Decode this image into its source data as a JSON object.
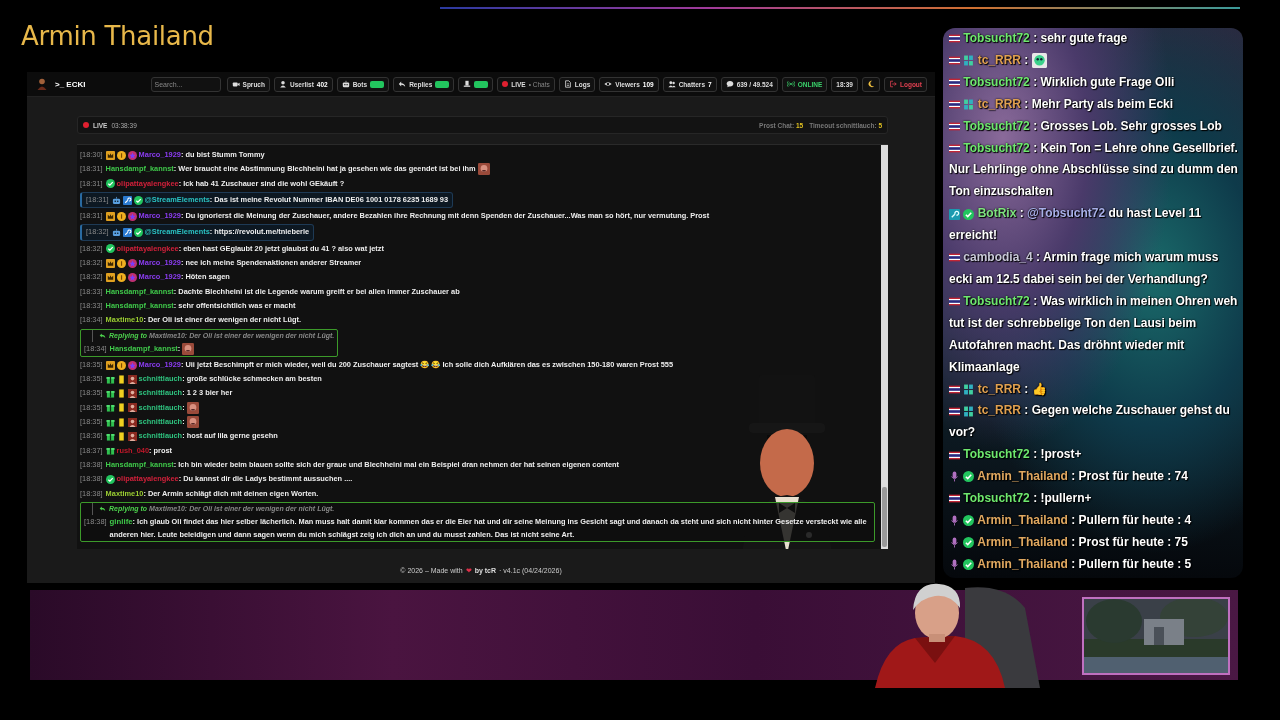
{
  "stream_title": "Armin Thailand",
  "nav": {
    "avatar": true,
    "logo": ">_ ECKI",
    "items": [
      {
        "kind": "search",
        "placeholder": "Search..."
      },
      {
        "kind": "button",
        "label": "Spruch"
      },
      {
        "kind": "button",
        "label": "Userlist",
        "count": "402"
      },
      {
        "kind": "toggle",
        "label": "Bots",
        "on": true
      },
      {
        "kind": "toggle",
        "label": "Replies",
        "on": true
      },
      {
        "kind": "toggle",
        "on": true
      },
      {
        "kind": "live",
        "label": "LIVE",
        "sub": "• Chats"
      },
      {
        "kind": "button",
        "label": "Logs"
      },
      {
        "kind": "button",
        "label": "Viewers",
        "count": "109"
      },
      {
        "kind": "button",
        "label": "Chatters",
        "count": "7"
      },
      {
        "kind": "button",
        "label": "639 / 49.524"
      },
      {
        "kind": "status",
        "label": "ONLINE"
      },
      {
        "kind": "plain",
        "label": "18:39"
      },
      {
        "kind": "button"
      },
      {
        "kind": "logout",
        "label": "Logout"
      }
    ]
  },
  "chat": {
    "live_label": "LIVE",
    "uptime": "03:38:39",
    "stats": [
      {
        "label": "Prost Chat:",
        "value": "15"
      },
      {
        "label": "Timeout schnittlauch:",
        "value": "5"
      }
    ],
    "separator": ":",
    "messages": [
      {
        "kind": "plain",
        "time": "[18:30]",
        "badges": [
          {
            "kind": "crown"
          },
          {
            "kind": "coin"
          },
          {
            "kind": "star"
          }
        ],
        "user": "Marco_1929",
        "color": "#8a3cf0",
        "text": "du bist Stumm Tommy"
      },
      {
        "kind": "plain",
        "time": "[18:31]",
        "user": "Hansdampf_kannst",
        "color": "#3fc94a",
        "text": "Wer braucht eine Abstimmung Blechheini hat ja gesehen wie das geendet ist bei ihm",
        "emote": true
      },
      {
        "kind": "plain",
        "time": "[18:31]",
        "badges": [
          {
            "kind": "check"
          }
        ],
        "user": "olipattayalengkee",
        "color": "#d0203a",
        "text": "Ick hab 41 Zuschauer sind die wohl GEkäuft ?"
      },
      {
        "kind": "highlight",
        "time": "[18:31]",
        "badges": [
          {
            "kind": "bot"
          },
          {
            "kind": "wrench"
          },
          {
            "kind": "check"
          }
        ],
        "user": "@StreamElements",
        "color": "#2ac1c1",
        "text": "Das ist meine Revolut Nummer IBAN DE06 1001 0178 6235 1689 93"
      },
      {
        "kind": "plain",
        "time": "[18:31]",
        "badges": [
          {
            "kind": "crown"
          },
          {
            "kind": "coin"
          },
          {
            "kind": "star"
          }
        ],
        "user": "Marco_1929",
        "color": "#8a3cf0",
        "text": "Du ignorierst die Meinung der Zuschauer, andere Bezahlen ihre Rechnung mit denn Spenden der Zuschauer...Was man so hört, nur vermutung. Prost"
      },
      {
        "kind": "highlight",
        "time": "[18:32]",
        "badges": [
          {
            "kind": "bot"
          },
          {
            "kind": "wrench"
          },
          {
            "kind": "check"
          }
        ],
        "user": "@StreamElements",
        "color": "#2ac1c1",
        "text": "https://revolut.me/tnieberle"
      },
      {
        "kind": "plain",
        "time": "[18:32]",
        "badges": [
          {
            "kind": "check"
          }
        ],
        "user": "olipattayalengkee",
        "color": "#d0203a",
        "text": "eben hast GEglaubt 20 jetzt glaubst du 41 ? also wat jetzt"
      },
      {
        "kind": "plain",
        "time": "[18:32]",
        "badges": [
          {
            "kind": "crown"
          },
          {
            "kind": "coin"
          },
          {
            "kind": "star"
          }
        ],
        "user": "Marco_1929",
        "color": "#8a3cf0",
        "text": "nee ich meine Spendenaktionen anderer Streamer"
      },
      {
        "kind": "plain",
        "time": "[18:32]",
        "badges": [
          {
            "kind": "crown"
          },
          {
            "kind": "coin"
          },
          {
            "kind": "star"
          }
        ],
        "user": "Marco_1929",
        "color": "#8a3cf0",
        "text": "Höten sagen"
      },
      {
        "kind": "plain",
        "time": "[18:33]",
        "user": "Hansdampf_kannst",
        "color": "#3fc94a",
        "text": "Dachte Blechheini ist die Legende warum greift er bei allen immer Zuschauer ab"
      },
      {
        "kind": "plain",
        "time": "[18:33]",
        "user": "Hansdampf_kannst",
        "color": "#3fc94a",
        "text": "sehr offentsichtlich was er macht"
      },
      {
        "kind": "plain",
        "time": "[18:34]",
        "user": "Maxtime10",
        "color": "#9acd32",
        "text": "Der Oli ist einer der wenigen der nicht Lügt."
      },
      {
        "kind": "reply",
        "reply_label": "Replying to",
        "reply_quote": "Maxtime10: Der Oli ist einer der wenigen der nicht Lügt.",
        "time": "[18:34]",
        "user": "Hansdampf_kannst",
        "color": "#3fc94a",
        "emote": true
      },
      {
        "kind": "plain",
        "time": "[18:35]",
        "badges": [
          {
            "kind": "crown"
          },
          {
            "kind": "coin"
          },
          {
            "kind": "star"
          }
        ],
        "user": "Marco_1929",
        "color": "#8a3cf0",
        "text": "Uii jetzt Beschimpft er mich wieder, weil du 200 Zuschauer sagtest 😂 😂 Ich solle dich Aufklären das es zwischen 150-180 waren Prost 555"
      },
      {
        "kind": "plain",
        "time": "[18:35]",
        "badges": [
          {
            "kind": "gift"
          },
          {
            "kind": "note"
          },
          {
            "kind": "avatar"
          }
        ],
        "user": "schnittlauch",
        "color": "#2ec27e",
        "text": "große schlücke schmecken am besten"
      },
      {
        "kind": "plain",
        "time": "[18:35]",
        "badges": [
          {
            "kind": "gift"
          },
          {
            "kind": "note"
          },
          {
            "kind": "avatar"
          }
        ],
        "user": "schnittlauch",
        "color": "#2ec27e",
        "text": "1 2 3 bier her"
      },
      {
        "kind": "plain",
        "time": "[18:35]",
        "badges": [
          {
            "kind": "gift"
          },
          {
            "kind": "note"
          },
          {
            "kind": "avatar"
          }
        ],
        "user": "schnittlauch",
        "color": "#2ec27e",
        "emote": true
      },
      {
        "kind": "plain",
        "time": "[18:35]",
        "badges": [
          {
            "kind": "gift"
          },
          {
            "kind": "note"
          },
          {
            "kind": "avatar"
          }
        ],
        "user": "schnittlauch",
        "color": "#2ec27e",
        "emote": true
      },
      {
        "kind": "plain",
        "time": "[18:36]",
        "badges": [
          {
            "kind": "gift"
          },
          {
            "kind": "note"
          },
          {
            "kind": "avatar"
          }
        ],
        "user": "schnittlauch",
        "color": "#2ec27e",
        "text": "host auf lila gerne gesehn"
      },
      {
        "kind": "plain",
        "time": "[18:37]",
        "badges": [
          {
            "kind": "gift"
          }
        ],
        "user": "rush_040",
        "color": "#c0182a",
        "text": "prost"
      },
      {
        "kind": "plain",
        "time": "[18:38]",
        "user": "Hansdampf_kannst",
        "color": "#3fc94a",
        "text": "Ich bin wieder beim blauen sollte sich der graue und Blechheini mal ein Beispiel dran nehmen der hat seinen eigenen content"
      },
      {
        "kind": "plain",
        "time": "[18:38]",
        "badges": [
          {
            "kind": "check"
          }
        ],
        "user": "olipattayalengkee",
        "color": "#d0203a",
        "text": "Du kannst dir die Ladys bestimmt aussuchen ...."
      },
      {
        "kind": "plain",
        "time": "[18:38]",
        "user": "Maxtime10",
        "color": "#9acd32",
        "text": "Der Armin schlägt dich mit deinen eigen Worten."
      },
      {
        "kind": "reply",
        "reply_label": "Replying to",
        "reply_quote": "Maxtime10: Der Oli ist einer der wenigen der nicht Lügt.",
        "time": "[18:38]",
        "user": "ginlife",
        "color": "#3fc94a",
        "text": "Ich glaub Oli findet das hier selber lächerlich. Man muss halt damit klar kommen das er die Eier hat und dir seine Meinung ins Gesicht sagt und danach da steht und sich nicht hinter Gesetze versteckt wie alle anderen hier. Leute beleidigen und dann sagen wenn du mich schlägst zeig ich dich an und du musst zahlen. Das ist nicht seine Art."
      }
    ]
  },
  "footer": {
    "text": "© 2026 – Made with",
    "heart": "❤",
    "author": "by tcR",
    "version": "· v4.1c (04/24/2026)"
  },
  "overlay_chat": {
    "separator": " : ",
    "messages": [
      {
        "badges": [
          {
            "kind": "flag"
          }
        ],
        "user": "Tobsucht72",
        "color": "#6ee86e",
        "text": "sehr gute frage"
      },
      {
        "badges": [
          {
            "kind": "flag"
          },
          {
            "kind": "sub"
          }
        ],
        "user": "tc_RRR",
        "color": "#e0a050",
        "emote": true
      },
      {
        "badges": [
          {
            "kind": "flag"
          }
        ],
        "user": "Tobsucht72",
        "color": "#6ee86e",
        "text": "Wirklich gute Frage Olli"
      },
      {
        "badges": [
          {
            "kind": "flag"
          },
          {
            "kind": "sub"
          }
        ],
        "user": "tc_RRR",
        "color": "#e0a050",
        "text": "Mehr Party als beim Ecki"
      },
      {
        "badges": [
          {
            "kind": "flag"
          }
        ],
        "user": "Tobsucht72",
        "color": "#6ee86e",
        "text": "Grosses Lob. Sehr grosses Lob"
      },
      {
        "badges": [
          {
            "kind": "flag"
          }
        ],
        "user": "Tobsucht72",
        "color": "#6ee86e",
        "text": "Kein Ton = Lehre ohne Gesellbrief. Nur Lehrlinge ohne Abschlüsse sind zu dumm den Ton einzuschalten"
      },
      {
        "badges": [
          {
            "kind": "kick"
          },
          {
            "kind": "check"
          }
        ],
        "user": "BotRix",
        "color": "#7ee37e",
        "mention": "@Tobsucht72",
        "text": "du hast Level 11 erreicht!"
      },
      {
        "badges": [
          {
            "kind": "flag"
          }
        ],
        "user": "cambodia_4",
        "color": "#c8c8d8",
        "text": "Armin frage mich warum muss ecki am 12.5 dabei sein bei der Verhandlung?"
      },
      {
        "badges": [
          {
            "kind": "flag"
          }
        ],
        "user": "Tobsucht72",
        "color": "#6ee86e",
        "text": "Was wirklich in meinen Ohren weh tut ist der schrebbelige Ton den Lausi beim Autofahren macht. Das dröhnt wieder mit Klimaanlage"
      },
      {
        "badges": [
          {
            "kind": "flag"
          },
          {
            "kind": "sub"
          }
        ],
        "user": "tc_RRR",
        "color": "#e0a050",
        "text": "👍"
      },
      {
        "badges": [
          {
            "kind": "flag"
          },
          {
            "kind": "sub"
          }
        ],
        "user": "tc_RRR",
        "color": "#e0a050",
        "text": "Gegen welche Zuschauer gehst du vor?"
      },
      {
        "badges": [
          {
            "kind": "flag"
          }
        ],
        "user": "Tobsucht72",
        "color": "#6ee86e",
        "text": "!prost+"
      },
      {
        "badges": [
          {
            "kind": "mic"
          },
          {
            "kind": "check"
          }
        ],
        "user": "Armin_Thailand",
        "color": "#e0a860",
        "text": "Prost für heute : 74"
      },
      {
        "badges": [
          {
            "kind": "flag"
          }
        ],
        "user": "Tobsucht72",
        "color": "#6ee86e",
        "text": "!pullern+"
      },
      {
        "badges": [
          {
            "kind": "mic"
          },
          {
            "kind": "check"
          }
        ],
        "user": "Armin_Thailand",
        "color": "#e0a860",
        "text": "Pullern für heute : 4"
      },
      {
        "badges": [
          {
            "kind": "mic"
          },
          {
            "kind": "check"
          }
        ],
        "user": "Armin_Thailand",
        "color": "#e0a860",
        "text": "Prost für heute : 75"
      },
      {
        "badges": [
          {
            "kind": "mic"
          },
          {
            "kind": "check"
          }
        ],
        "user": "Armin_Thailand",
        "color": "#e0a860",
        "text": "Pullern für heute : 5"
      }
    ]
  }
}
